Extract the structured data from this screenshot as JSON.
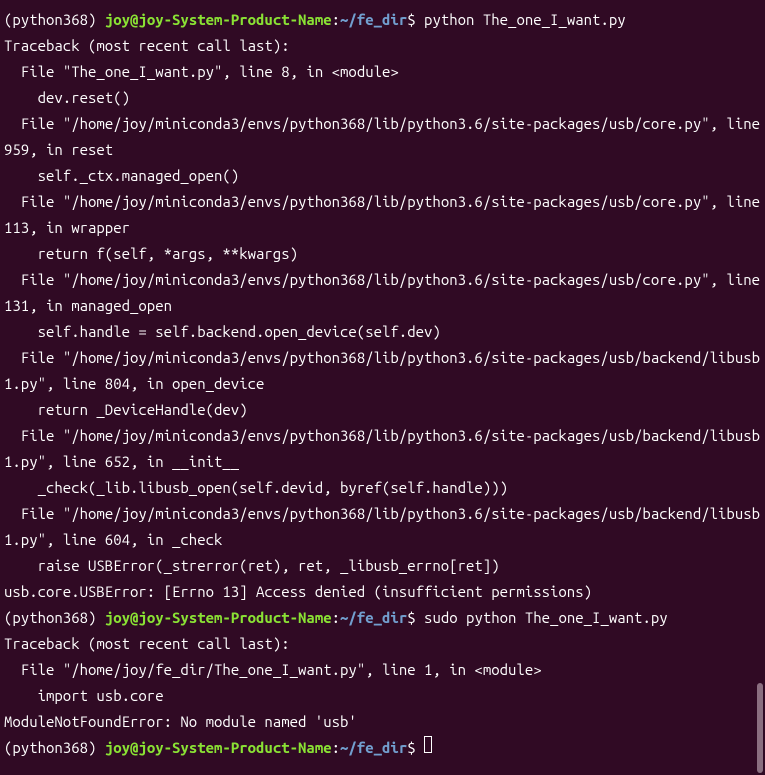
{
  "prompt": {
    "env": "(python368) ",
    "userhost": "joy@joy-System-Product-Name",
    "colon": ":",
    "path": "~/fe_dir",
    "dollar": "$ "
  },
  "cmd1": "python The_one_I_want.py",
  "cmd2": "sudo python The_one_I_want.py",
  "trace1": {
    "l0": "Traceback (most recent call last):",
    "l1": "  File \"The_one_I_want.py\", line 8, in <module>",
    "l2": "    dev.reset()",
    "l3": "  File \"/home/joy/miniconda3/envs/python368/lib/python3.6/site-packages/usb/core.py\", line 959, in reset",
    "l4": "    self._ctx.managed_open()",
    "l5": "  File \"/home/joy/miniconda3/envs/python368/lib/python3.6/site-packages/usb/core.py\", line 113, in wrapper",
    "l6": "    return f(self, *args, **kwargs)",
    "l7": "  File \"/home/joy/miniconda3/envs/python368/lib/python3.6/site-packages/usb/core.py\", line 131, in managed_open",
    "l8": "    self.handle = self.backend.open_device(self.dev)",
    "l9": "  File \"/home/joy/miniconda3/envs/python368/lib/python3.6/site-packages/usb/backend/libusb1.py\", line 804, in open_device",
    "l10": "    return _DeviceHandle(dev)",
    "l11": "  File \"/home/joy/miniconda3/envs/python368/lib/python3.6/site-packages/usb/backend/libusb1.py\", line 652, in __init__",
    "l12": "    _check(_lib.libusb_open(self.devid, byref(self.handle)))",
    "l13": "  File \"/home/joy/miniconda3/envs/python368/lib/python3.6/site-packages/usb/backend/libusb1.py\", line 604, in _check",
    "l14": "    raise USBError(_strerror(ret), ret, _libusb_errno[ret])",
    "l15": "usb.core.USBError: [Errno 13] Access denied (insufficient permissions)"
  },
  "trace2": {
    "l0": "Traceback (most recent call last):",
    "l1": "  File \"/home/joy/fe_dir/The_one_I_want.py\", line 1, in <module>",
    "l2": "    import usb.core",
    "l3": "ModuleNotFoundError: No module named 'usb'"
  }
}
